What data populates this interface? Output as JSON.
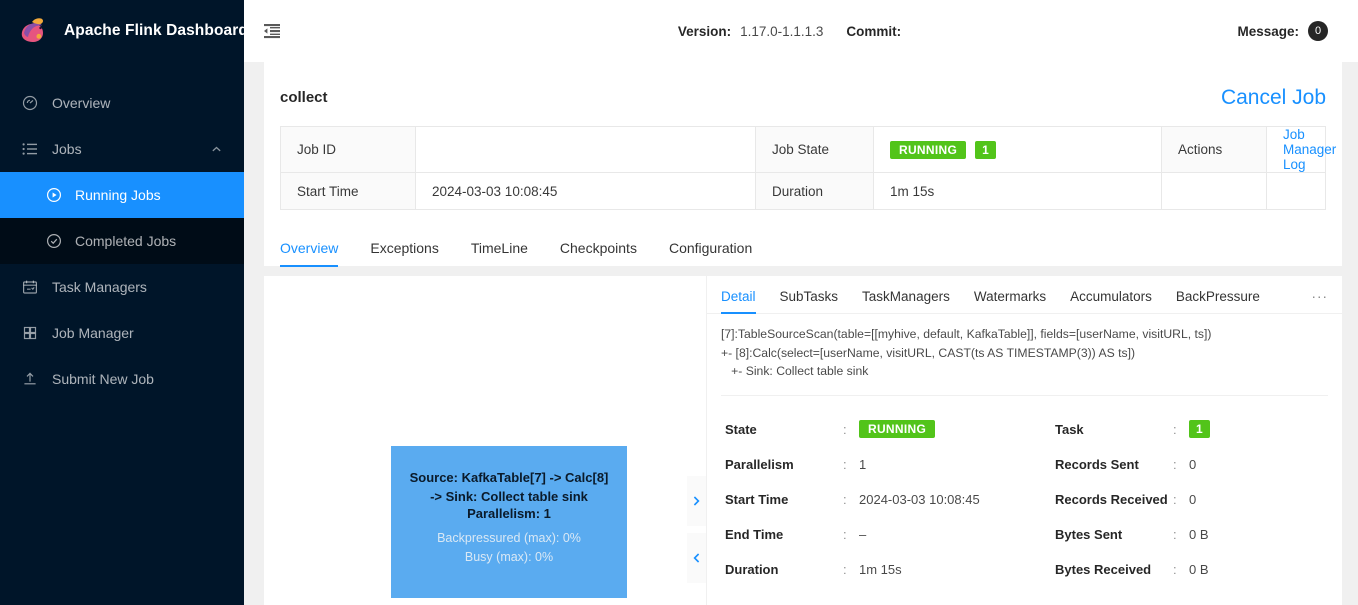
{
  "sidebar": {
    "brand": "Apache Flink Dashboard",
    "logo_icon": "flink-squirrel-logo",
    "items": [
      {
        "label": "Overview",
        "icon": "dashboard-icon"
      },
      {
        "label": "Jobs",
        "icon": "list-icon",
        "caret": "chevron-up-icon"
      },
      {
        "label": "Task Managers",
        "icon": "calendar-check-icon"
      },
      {
        "label": "Job Manager",
        "icon": "block-grid-icon"
      },
      {
        "label": "Submit New Job",
        "icon": "upload-icon"
      }
    ],
    "submenu": [
      {
        "label": "Running Jobs",
        "icon": "play-circle-icon",
        "active": true
      },
      {
        "label": "Completed Jobs",
        "icon": "check-circle-icon",
        "active": false
      }
    ]
  },
  "topbar": {
    "fold_icon": "menu-fold-icon",
    "version_label": "Version:",
    "version_value": "1.17.0-1.1.1.3",
    "commit_label": "Commit:",
    "commit_value": "",
    "message_label": "Message:",
    "message_count": "0"
  },
  "job": {
    "name": "collect",
    "cancel_label": "Cancel Job",
    "rows": [
      {
        "label1": "Job ID",
        "value1": "",
        "label2": "Job State",
        "state": "RUNNING",
        "state_count": "1",
        "label3": "Actions",
        "value3": "Job Manager Log"
      },
      {
        "label1": "Start Time",
        "value1": "2024-03-03 10:08:45",
        "label2": "Duration",
        "value2": "1m 15s"
      }
    ]
  },
  "tabs": [
    {
      "label": "Overview",
      "active": true
    },
    {
      "label": "Exceptions",
      "active": false
    },
    {
      "label": "TimeLine",
      "active": false
    },
    {
      "label": "Checkpoints",
      "active": false
    },
    {
      "label": "Configuration",
      "active": false
    }
  ],
  "graph": {
    "node": {
      "title_line1": "Source: KafkaTable[7] -> Calc[8]",
      "title_line2": "-> Sink: Collect table sink",
      "parallelism": "Parallelism: 1",
      "backpressured": "Backpressured (max): 0%",
      "busy": "Busy (max): 0%",
      "color": "#5aabf0"
    },
    "arrow_right_icon": "chevron-right-icon",
    "arrow_left_icon": "chevron-left-icon"
  },
  "detail": {
    "tabs": [
      {
        "label": "Detail",
        "active": true
      },
      {
        "label": "SubTasks",
        "active": false
      },
      {
        "label": "TaskManagers",
        "active": false
      },
      {
        "label": "Watermarks",
        "active": false
      },
      {
        "label": "Accumulators",
        "active": false
      },
      {
        "label": "BackPressure",
        "active": false
      }
    ],
    "more_label": "···",
    "plan": "[7]:TableSourceScan(table=[[myhive, default, KafkaTable]], fields=[userName, visitURL, ts])\n+- [8]:Calc(select=[userName, visitURL, CAST(ts AS TIMESTAMP(3)) AS ts])\n   +- Sink: Collect table sink",
    "left_fields": [
      {
        "key": "State",
        "value": "RUNNING",
        "badge": true
      },
      {
        "key": "Parallelism",
        "value": "1",
        "badge": false
      },
      {
        "key": "Start Time",
        "value": "2024-03-03 10:08:45",
        "badge": false
      },
      {
        "key": "End Time",
        "value": "–",
        "badge": false
      },
      {
        "key": "Duration",
        "value": "1m 15s",
        "badge": false
      }
    ],
    "right_fields": [
      {
        "key": "Task",
        "value": "1",
        "badge": true
      },
      {
        "key": "Records Sent",
        "value": "0",
        "badge": false
      },
      {
        "key": "Records Received",
        "value": "0",
        "badge": false
      },
      {
        "key": "Bytes Sent",
        "value": "0 B",
        "badge": false
      },
      {
        "key": "Bytes Received",
        "value": "0 B",
        "badge": false
      }
    ],
    "separator": ":"
  },
  "colors": {
    "accent": "#1890ff",
    "success": "#52c41a",
    "sidebar_bg": "#001529",
    "submenu_bg": "#000c17",
    "page_bg": "#f0f0f0"
  }
}
